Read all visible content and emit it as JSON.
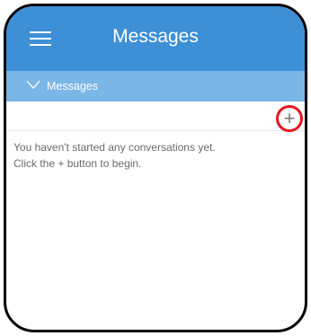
{
  "header": {
    "title": "Messages",
    "menu_icon": "hamburger-menu-icon",
    "background_color": "#3d8fd6"
  },
  "section": {
    "label": "Messages",
    "expand_icon": "chevron-down-icon",
    "background_color": "#7ab6e6"
  },
  "toolbar": {
    "add_icon": "plus-icon",
    "add_label": "+",
    "highlight_color": "#e8171f"
  },
  "empty_state": {
    "line1": "You haven't started any conversations yet.",
    "line2": "Click the + button to begin."
  }
}
